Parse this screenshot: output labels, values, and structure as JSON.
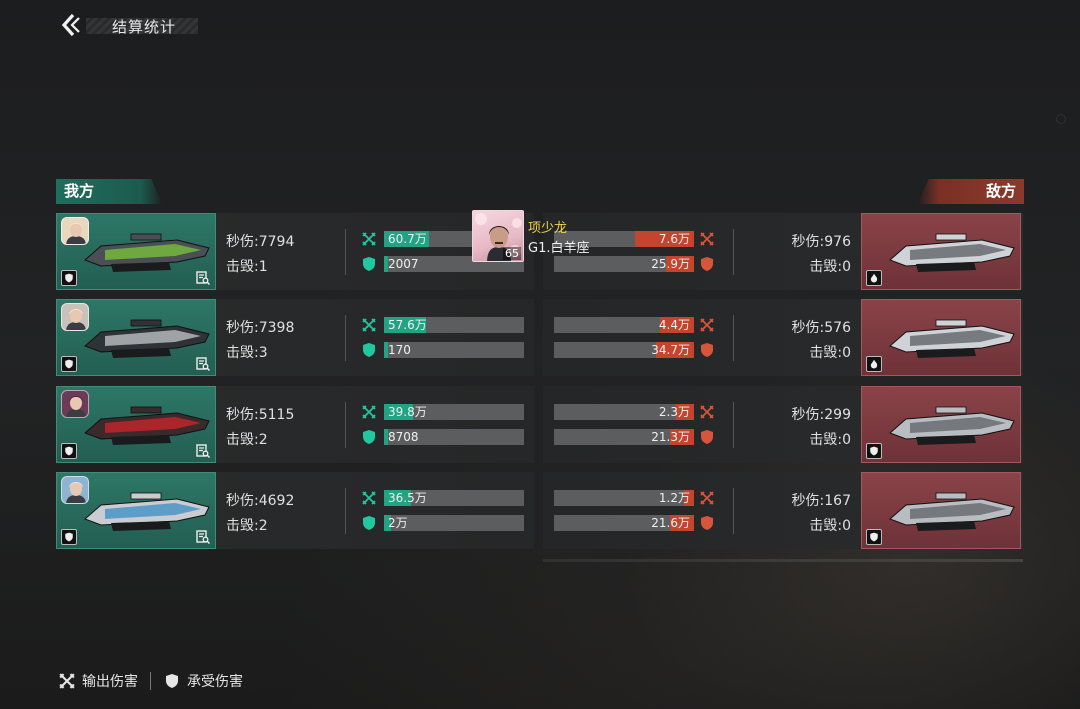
{
  "header": {
    "title": "结算统计"
  },
  "sides": {
    "ally": "我方",
    "enemy": "敌方"
  },
  "ally_rows": [
    {
      "dps": "秒伤:7794",
      "kills": "击毁:1",
      "damage_out": "60.7万",
      "damage_out_ratio": 0.32,
      "damage_in": "2007",
      "damage_in_ratio": 0.02
    },
    {
      "dps": "秒伤:7398",
      "kills": "击毁:3",
      "damage_out": "57.6万",
      "damage_out_ratio": 0.3,
      "damage_in": "170",
      "damage_in_ratio": 0.01
    },
    {
      "dps": "秒伤:5115",
      "kills": "击毁:2",
      "damage_out": "39.8万",
      "damage_out_ratio": 0.21,
      "damage_in": "8708",
      "damage_in_ratio": 0.03
    },
    {
      "dps": "秒伤:4692",
      "kills": "击毁:2",
      "damage_out": "36.5万",
      "damage_out_ratio": 0.19,
      "damage_in": "2万",
      "damage_in_ratio": 0.05
    }
  ],
  "enemy_rows": [
    {
      "dps": "秒伤:976",
      "kills": "击毁:0",
      "damage_out": "7.6万",
      "damage_out_ratio": 0.42,
      "damage_in": "25.9万",
      "damage_in_ratio": 0.2
    },
    {
      "dps": "秒伤:576",
      "kills": "击毁:0",
      "damage_out": "4.4万",
      "damage_out_ratio": 0.24,
      "damage_in": "34.7万",
      "damage_in_ratio": 0.27
    },
    {
      "dps": "秒伤:299",
      "kills": "击毁:0",
      "damage_out": "2.3万",
      "damage_out_ratio": 0.13,
      "damage_in": "21.3万",
      "damage_in_ratio": 0.17
    },
    {
      "dps": "秒伤:167",
      "kills": "击毁:0",
      "damage_out": "1.2万",
      "damage_out_ratio": 0.07,
      "damage_in": "21.6万",
      "damage_in_ratio": 0.17
    }
  ],
  "tooltip": {
    "name": "项少龙",
    "level": "65",
    "subtitle": "G1.白羊座"
  },
  "legend": {
    "damage_out": "输出伤害",
    "damage_in": "承受伤害"
  },
  "colors": {
    "ally_accent": "#21a384",
    "enemy_accent": "#c3452e",
    "ally_card": "#2d7767",
    "enemy_card": "#8a4348",
    "tooltip_name": "#f4d34f"
  }
}
